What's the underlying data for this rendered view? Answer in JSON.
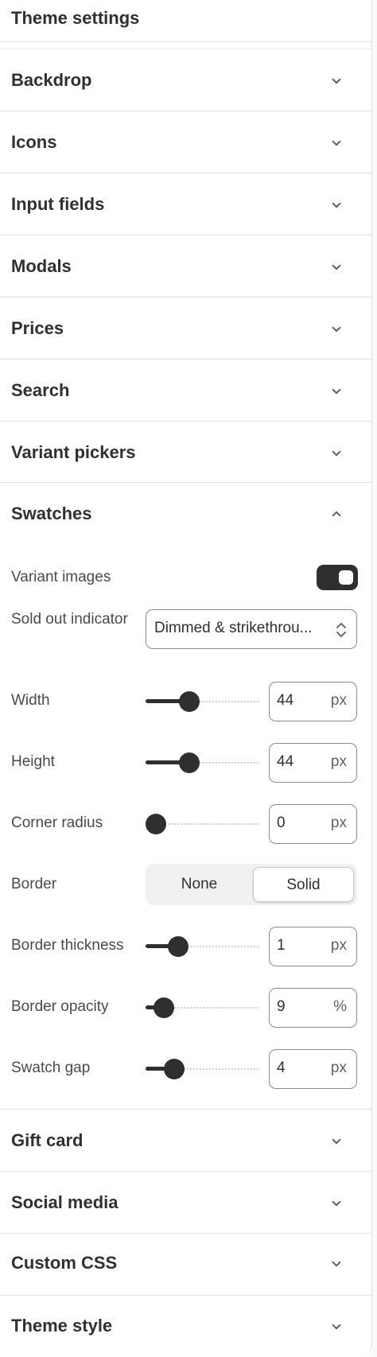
{
  "header": {
    "title": "Theme settings"
  },
  "sections_top": [
    {
      "title": "Backdrop"
    },
    {
      "title": "Icons"
    },
    {
      "title": "Input fields"
    },
    {
      "title": "Modals"
    },
    {
      "title": "Prices"
    },
    {
      "title": "Search"
    },
    {
      "title": "Variant pickers"
    }
  ],
  "swatches": {
    "title": "Swatches",
    "expanded": true,
    "variant_images": {
      "label": "Variant images",
      "enabled": true
    },
    "sold_out": {
      "label": "Sold out indicator",
      "value": "Dimmed & strikethrou..."
    },
    "sliders": [
      {
        "label": "Width",
        "value": "44",
        "unit": "px",
        "fraction": 0.36
      },
      {
        "label": "Height",
        "value": "44",
        "unit": "px",
        "fraction": 0.36
      },
      {
        "label": "Corner radius",
        "value": "0",
        "unit": "px",
        "fraction": 0.0
      },
      {
        "label": "Border thickness",
        "value": "1",
        "unit": "px",
        "fraction": 0.24
      },
      {
        "label": "Border opacity",
        "value": "9",
        "unit": "%",
        "fraction": 0.09
      },
      {
        "label": "Swatch gap",
        "value": "4",
        "unit": "px",
        "fraction": 0.2
      }
    ],
    "border": {
      "label": "Border",
      "options": [
        "None",
        "Solid"
      ],
      "selected": "Solid"
    }
  },
  "sections_bottom": [
    {
      "title": "Gift card"
    },
    {
      "title": "Social media"
    },
    {
      "title": "Custom CSS"
    },
    {
      "title": "Theme style"
    }
  ],
  "colors": {
    "text": "#303030",
    "control_dark": "#2f2f2f",
    "border": "#e3e3e3"
  }
}
